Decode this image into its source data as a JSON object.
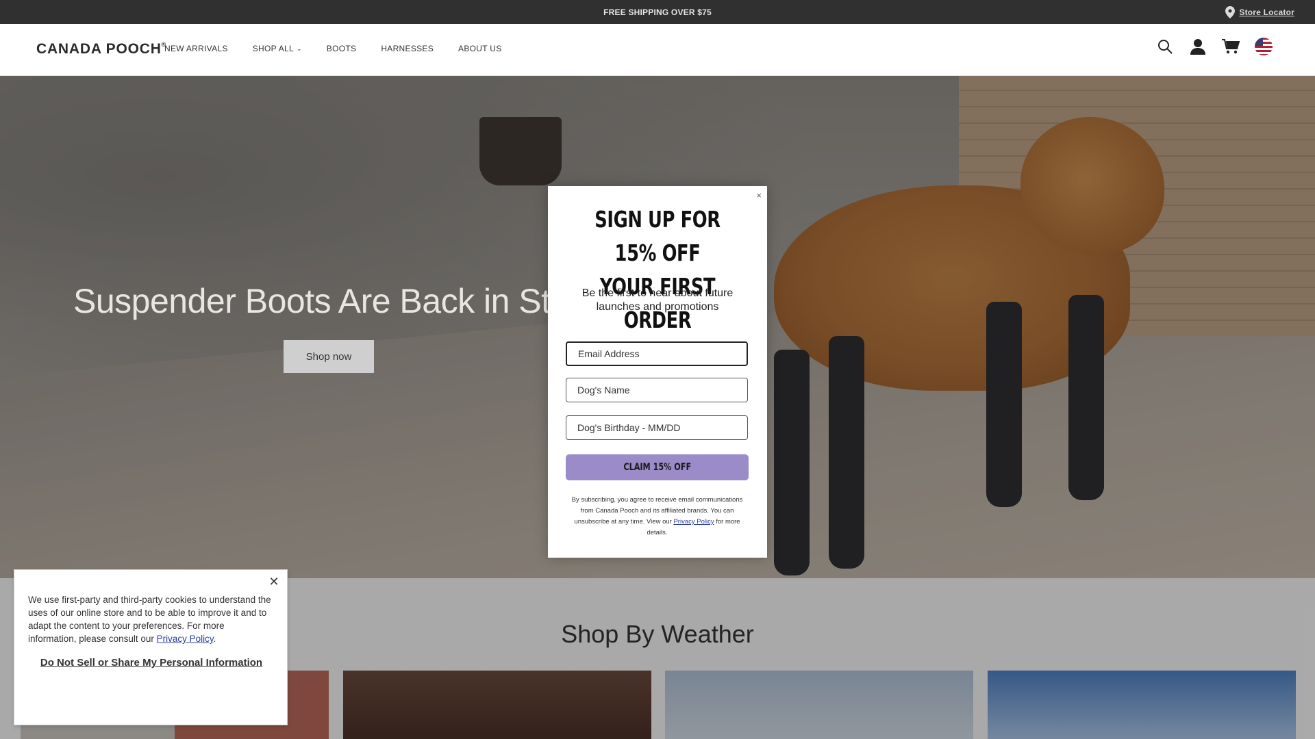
{
  "announcement": {
    "text": "FREE SHIPPING OVER $75",
    "store_locator": "Store Locator"
  },
  "header": {
    "logo": "CANADA POOCH",
    "logo_mark": "®",
    "nav": [
      "NEW ARRIVALS",
      "SHOP ALL",
      "BOOTS",
      "HARNESSES",
      "ABOUT US"
    ],
    "icons": [
      "search-icon",
      "account-icon",
      "cart-icon",
      "us-flag-icon"
    ]
  },
  "hero": {
    "title": "Suspender Boots Are Back in Stock",
    "cta": "Shop now"
  },
  "section": {
    "title": "Shop By Weather"
  },
  "modal": {
    "title_line1": "SIGN UP FOR 15% OFF",
    "title_line2": "YOUR FIRST ORDER",
    "subtitle": "Be the first to hear about future launches and promotions",
    "email_placeholder": "Email Address",
    "dog_name_placeholder": "Dog's Name",
    "birthday_placeholder": "Dog's Birthday - MM/DD",
    "cta": "CLAIM 15% OFF",
    "legal_before": "By subscribing, you agree to receive email communications from Canada Pooch and its affiliated brands. You can unsubscribe at any time. View our",
    "legal_link": "Privacy Policy",
    "legal_after": "for more details.",
    "close": "×"
  },
  "cookie": {
    "text": "We use first-party and third-party cookies to understand the uses of our online store and to be able to improve it and to adapt the content to your preferences. For more information, please consult our",
    "link": "Privacy Policy",
    "dns": "Do Not Sell or Share My Personal Information",
    "close": "✕"
  },
  "colors": {
    "announcement_bg": "#303030",
    "cta_purple": "#9b8bc8",
    "link_blue": "#2b3f9a"
  }
}
